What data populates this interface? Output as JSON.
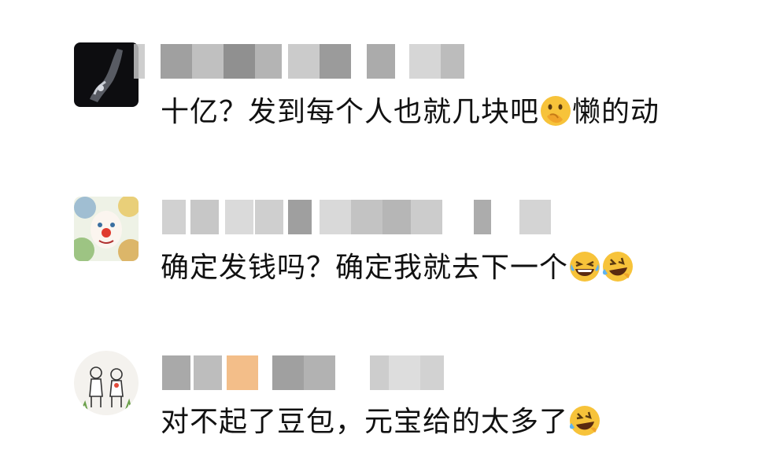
{
  "comments": [
    {
      "avatar": "dark-hand-photo",
      "username_obscured": true,
      "text_before": "十亿？发到每个人也就几块吧",
      "emoji": "thinking-face",
      "text_after": "懒的动"
    },
    {
      "avatar": "clown-painting",
      "username_obscured": true,
      "text_before": "确定发钱吗？确定我就去下一个",
      "emoji": "laughing-tears-pair",
      "text_after": ""
    },
    {
      "avatar": "sketch-couple",
      "username_obscured": true,
      "text_before": "对不起了豆包，元宝给的太多了",
      "emoji": "rolling-laughing-face",
      "text_after": ""
    }
  ],
  "colors": {
    "text": "#111111",
    "blur_gray": "#9a9a9a",
    "emoji_yellow": "#f7c33a"
  }
}
